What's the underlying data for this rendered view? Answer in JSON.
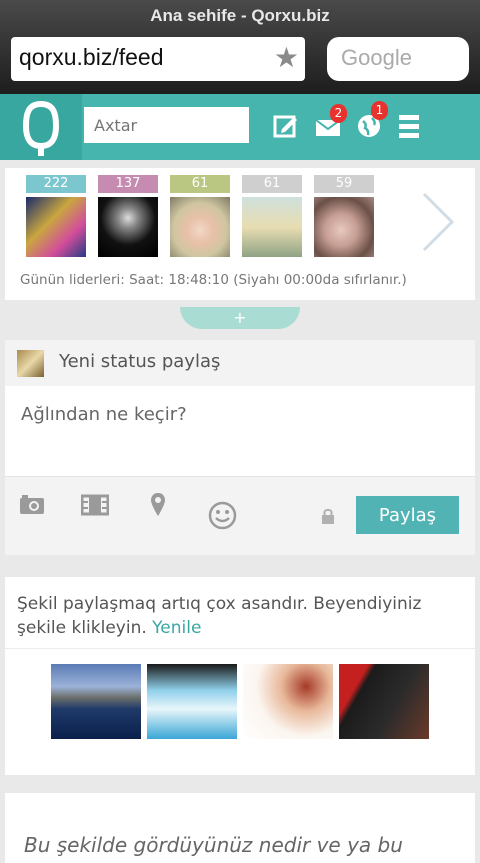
{
  "browser": {
    "title": "Ana sehife - Qorxu.biz",
    "url": "qorxu.biz/feed",
    "search_placeholder": "Google"
  },
  "header": {
    "search_placeholder": "Axtar",
    "messages_badge": "2",
    "notifications_badge": "1",
    "accent": "#45b5ad"
  },
  "leaders": {
    "counts": [
      "222",
      "137",
      "61",
      "61",
      "59"
    ],
    "badge_colors": [
      "#7cc7cf",
      "#c58bb0",
      "#b9c783",
      "#cfcfcf",
      "#cfcfcf"
    ],
    "info": "Günün liderleri: Saat: 18:48:10 (Siyahı 00:00da sıfırlanır.)",
    "expand_label": "+"
  },
  "status": {
    "title": "Yeni status paylaş",
    "placeholder": "Ağlından ne keçir?",
    "share_label": "Paylaş"
  },
  "photos": {
    "text": "Şekil paylaşmaq artıq çox asandır. Beyendiyiniz şekile klikleyin.",
    "link": "Yenile"
  },
  "question": {
    "text": "Bu şekilde gördüyünüz nedir ve ya bu"
  }
}
